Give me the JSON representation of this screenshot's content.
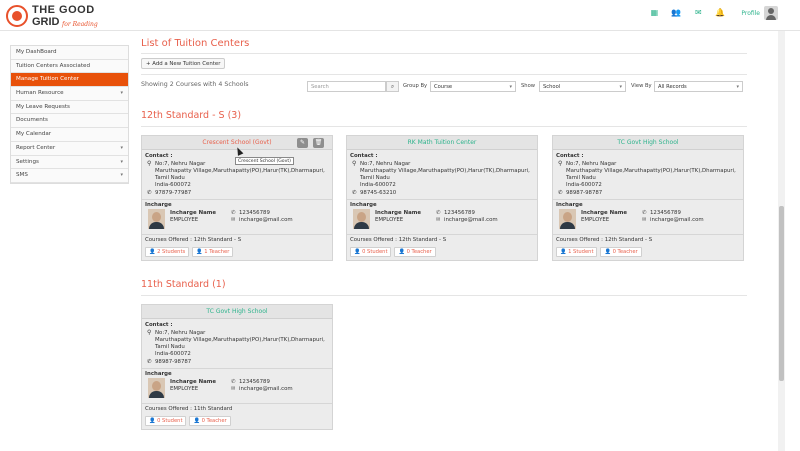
{
  "app": {
    "logo_line1": "THE GOOD",
    "logo_line2": "GRID",
    "logo_sub": "for Reading",
    "profile_label": "Profile"
  },
  "top_icons": [
    "grid-icon",
    "users-icon",
    "mail-icon",
    "bell-icon"
  ],
  "sidebar": {
    "items": [
      {
        "label": "My DashBoard",
        "active": false,
        "caret": false
      },
      {
        "label": "Tuition Centers Associated",
        "active": false,
        "caret": false
      },
      {
        "label": "Manage Tuition Center",
        "active": true,
        "caret": false
      },
      {
        "label": "Human Resource",
        "active": false,
        "caret": true
      },
      {
        "label": "My Leave Requests",
        "active": false,
        "caret": false
      },
      {
        "label": "Documents",
        "active": false,
        "caret": false
      },
      {
        "label": "My Calendar",
        "active": false,
        "caret": false
      },
      {
        "label": "Report Center",
        "active": false,
        "caret": true
      },
      {
        "label": "Settings",
        "active": false,
        "caret": true
      },
      {
        "label": "SMS",
        "active": false,
        "caret": true
      }
    ]
  },
  "page": {
    "title": "List of Tuition Centers",
    "add_button": "+ Add a New Tuition Center",
    "showing": "Showing 2 Courses with 4 Schools",
    "search_placeholder": "Search",
    "group_by_label": "Group By",
    "group_by_value": "Course",
    "show_label": "Show",
    "show_value": "School",
    "view_by_label": "View By",
    "view_by_value": "All Records"
  },
  "sections": [
    {
      "title": "12th Standard - S (3)",
      "cards": [
        {
          "name": "Crescent School (Govt)",
          "color": "red",
          "editable": true,
          "contact_label": "Contact :",
          "address": [
            "No:7, Nehru Nagar",
            "Maruthapatty Village,Maruthapatty(PO),Harur(TK),Dharmapuri,",
            "Tamil Nadu",
            "India-600072"
          ],
          "phone": "97879-77987",
          "incharge_label": "Incharge",
          "incharge_name": "Incharge Name",
          "incharge_role": "EMPLOYEE",
          "incharge_phone": "123456789",
          "incharge_mail": "incharge@mail.com",
          "courses": "Courses Offered : 12th Standard - S",
          "students": "2 Students",
          "teachers": "1 Teacher"
        },
        {
          "name": "RK Math Tuition Center",
          "color": "green",
          "editable": false,
          "contact_label": "Contact :",
          "address": [
            "No:7, Nehru Nagar",
            "Maruthapatty Village,Maruthapatty(PO),Harur(TK),Dharmapuri,",
            "Tamil Nadu",
            "India-600072"
          ],
          "phone": "98745-63210",
          "incharge_label": "Incharge",
          "incharge_name": "Incharge Name",
          "incharge_role": "EMPLOYEE",
          "incharge_phone": "123456789",
          "incharge_mail": "incharge@mail.com",
          "courses": "Courses Offered : 12th Standard - S",
          "students": "0 Student",
          "teachers": "0 Teacher"
        },
        {
          "name": "TC Govt High School",
          "color": "green",
          "editable": false,
          "contact_label": "Contact :",
          "address": [
            "No:7, Nehru Nagar",
            "Maruthapatty Village,Maruthapatty(PO),Harur(TK),Dharmapuri,",
            "Tamil Nadu",
            "India-600072"
          ],
          "phone": "98987-98787",
          "incharge_label": "Incharge",
          "incharge_name": "Incharge Name",
          "incharge_role": "EMPLOYEE",
          "incharge_phone": "123456789",
          "incharge_mail": "incharge@mail.com",
          "courses": "Courses Offered : 12th Standard - S",
          "students": "1 Student",
          "teachers": "0 Teacher"
        }
      ]
    },
    {
      "title": "11th Standard (1)",
      "cards": [
        {
          "name": "TC Govt High School",
          "color": "green",
          "editable": false,
          "contact_label": "Contact :",
          "address": [
            "No:7, Nehru Nagar",
            "Maruthapatty Village,Maruthapatty(PO),Harur(TK),Dharmapuri,",
            "Tamil Nadu",
            "India-600072"
          ],
          "phone": "98987-98787",
          "incharge_label": "Incharge",
          "incharge_name": "Incharge Name",
          "incharge_role": "EMPLOYEE",
          "incharge_phone": "123456789",
          "incharge_mail": "incharge@mail.com",
          "courses": "Courses Offered : 11th Standard",
          "students": "0 Student",
          "teachers": "0 Teacher"
        }
      ]
    }
  ],
  "tooltip": "Crescent School (Govt)"
}
